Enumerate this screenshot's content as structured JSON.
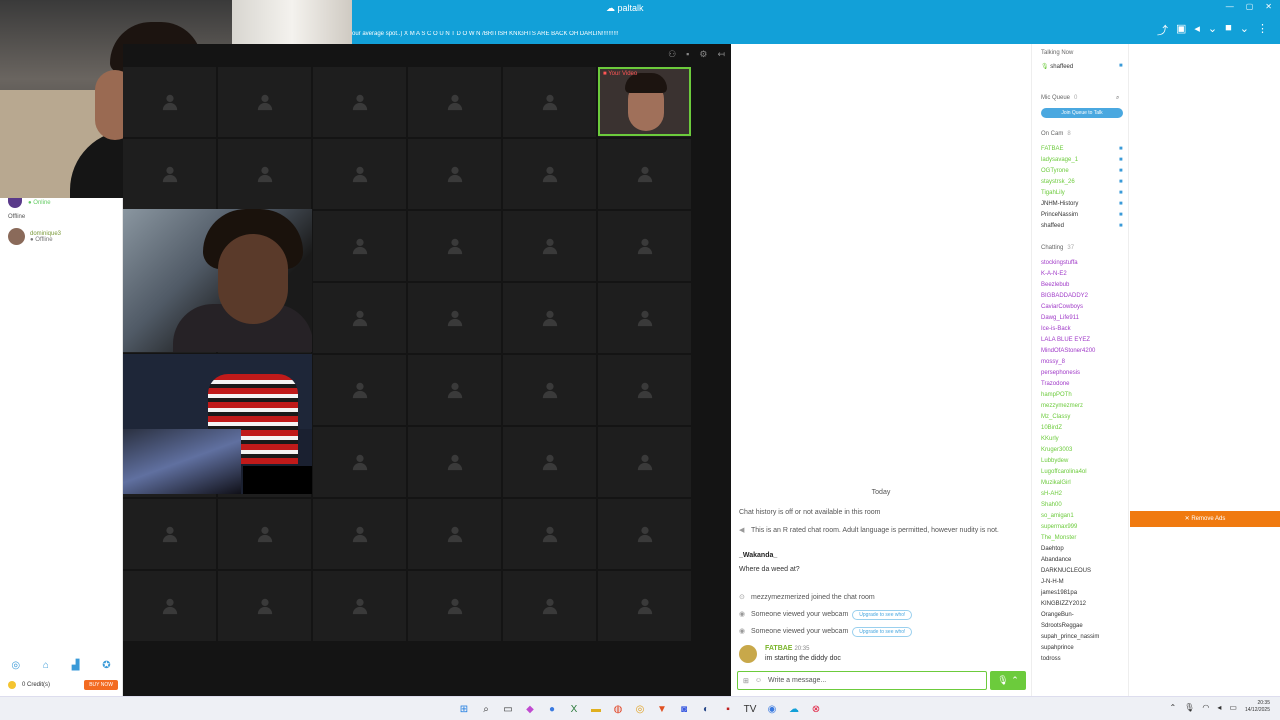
{
  "app": {
    "brand": "paltalk",
    "room_subtitle": "our average spot..) X M A S C O U N T D O W N /BRITISH KNIGHTS ARE BACK OH DARLIN!!!!!!!!!!"
  },
  "left_panel": {
    "online_status": "Online",
    "offline_header": "Offline",
    "contact": {
      "name": "dominique3",
      "status": "Offline"
    },
    "credits": "0 Credit(s)",
    "buy_now": "BUY NOW"
  },
  "video": {
    "self_label": "Your Video"
  },
  "chat": {
    "today_label": "Today",
    "history_off": "Chat history is off or not available in this room",
    "rated_notice": "This is an R rated chat room. Adult language is permitted, however nudity is not.",
    "msg1_user": "_Wakanda_",
    "msg1_text": "Where da weed at?",
    "join_notice": "mezzymezmerized joined the chat room",
    "webcam_notice_1": "Someone viewed your webcam",
    "webcam_notice_2": "Someone viewed your webcam",
    "upgrade_label": "Upgrade to see who!",
    "last_user": "FATBAE",
    "last_time": "20:35",
    "last_text": "im starting the diddy doc",
    "composer_placeholder": "Write a message..."
  },
  "users": {
    "talking_now_header": "Talking Now",
    "talking_now": [
      "shaffeed"
    ],
    "mic_queue_header": "Mic Queue",
    "mic_queue_count": "0",
    "join_queue": "Join Queue to Talk",
    "on_cam_header": "On Cam",
    "on_cam_count": "8",
    "on_cam": [
      {
        "name": "FATBAE",
        "color": "#6ccb3c"
      },
      {
        "name": "ladysavage_1",
        "color": "#6ccb3c"
      },
      {
        "name": "OGTyrone",
        "color": "#6ccb3c"
      },
      {
        "name": "staystrsk_26",
        "color": "#6ccb3c"
      },
      {
        "name": "TigahLily",
        "color": "#6ccb3c"
      },
      {
        "name": "JNHM-History",
        "color": "#333333"
      },
      {
        "name": "PrinceNassim",
        "color": "#333333"
      },
      {
        "name": "shaffeed",
        "color": "#333333"
      }
    ],
    "chatting_header": "Chatting",
    "chatting_count": "37",
    "chatting": [
      {
        "name": "stockingstuffa",
        "color": "#a03ac8"
      },
      {
        "name": "K-A-N-E2",
        "color": "#a03ac8"
      },
      {
        "name": "Beezlebub",
        "color": "#a03ac8"
      },
      {
        "name": "BIGBADDADDY2",
        "color": "#a03ac8"
      },
      {
        "name": "CaviarCowboys",
        "color": "#a03ac8"
      },
      {
        "name": "Dawg_Life911",
        "color": "#a03ac8"
      },
      {
        "name": "Ice-is-Back",
        "color": "#a03ac8"
      },
      {
        "name": "LALA BLUE EYEZ",
        "color": "#a03ac8"
      },
      {
        "name": "MindOfAStoner4200",
        "color": "#a03ac8"
      },
      {
        "name": "mossy_8",
        "color": "#a03ac8"
      },
      {
        "name": "persephonesis",
        "color": "#a03ac8"
      },
      {
        "name": "Trazodone",
        "color": "#a03ac8"
      },
      {
        "name": "hampPOTh",
        "color": "#6ccb3c"
      },
      {
        "name": "mezzymezmerz",
        "color": "#6ccb3c"
      },
      {
        "name": "Mz_Classy",
        "color": "#6ccb3c"
      },
      {
        "name": "10BirdZ",
        "color": "#6ccb3c"
      },
      {
        "name": "KKurly",
        "color": "#6ccb3c"
      },
      {
        "name": "Kruger3003",
        "color": "#6ccb3c"
      },
      {
        "name": "Lubbydew",
        "color": "#6ccb3c"
      },
      {
        "name": "Lugoffcarolina4ol",
        "color": "#6ccb3c"
      },
      {
        "name": "MuzikalGirl",
        "color": "#6ccb3c"
      },
      {
        "name": "sH-AH2",
        "color": "#6ccb3c"
      },
      {
        "name": "Shah00",
        "color": "#6ccb3c"
      },
      {
        "name": "so_amigan1",
        "color": "#6ccb3c"
      },
      {
        "name": "supermax999",
        "color": "#6ccb3c"
      },
      {
        "name": "The_Monster",
        "color": "#6ccb3c"
      },
      {
        "name": "Daehtop",
        "color": "#333333"
      },
      {
        "name": "Abandance",
        "color": "#333333"
      },
      {
        "name": "DARKNUCLEOUS",
        "color": "#333333"
      },
      {
        "name": "J-N-H-M",
        "color": "#333333"
      },
      {
        "name": "james1981pa",
        "color": "#333333"
      },
      {
        "name": "KINGBIZZY2012",
        "color": "#333333"
      },
      {
        "name": "OrangeBun-",
        "color": "#333333"
      },
      {
        "name": "SdrootsReggae",
        "color": "#333333"
      },
      {
        "name": "supah_prince_nassim",
        "color": "#333333"
      },
      {
        "name": "supahprince",
        "color": "#333333"
      },
      {
        "name": "todross",
        "color": "#333333"
      }
    ]
  },
  "ads": {
    "remove_ads": "✕ Remove Ads"
  },
  "taskbar": {
    "time": "20:35",
    "date": "14/12/2025"
  }
}
